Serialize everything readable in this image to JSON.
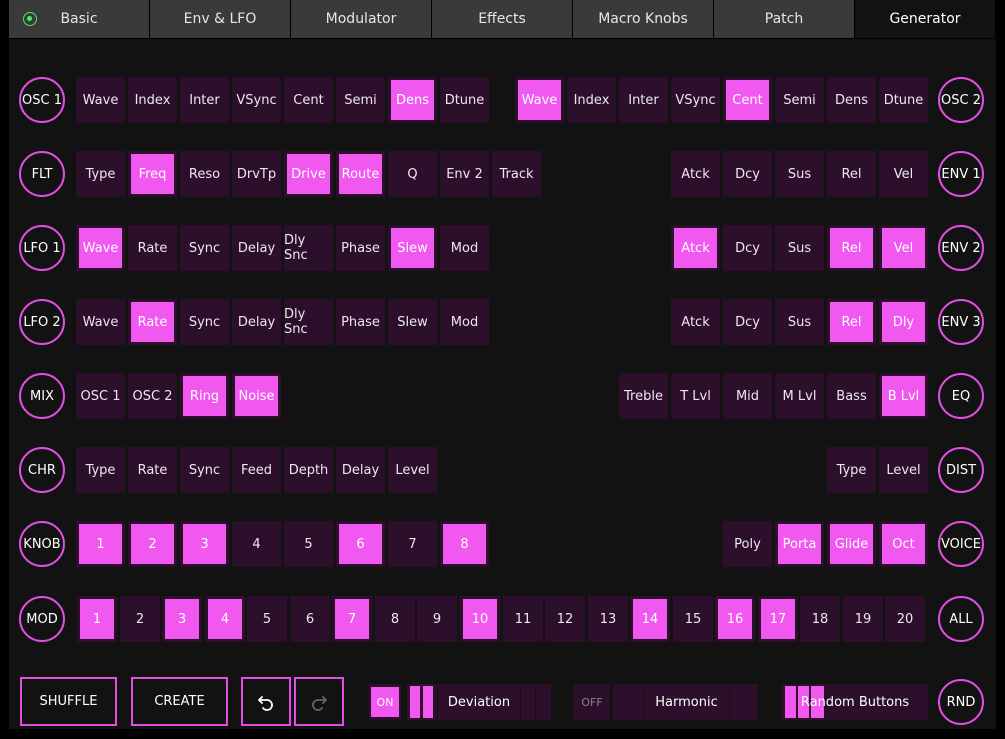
{
  "tabs": [
    {
      "label": "Basic",
      "active": false,
      "led": true
    },
    {
      "label": "Env & LFO",
      "active": false
    },
    {
      "label": "Modulator",
      "active": false
    },
    {
      "label": "Effects",
      "active": false
    },
    {
      "label": "Macro Knobs",
      "active": false
    },
    {
      "label": "Patch",
      "active": false
    },
    {
      "label": "Generator",
      "active": true
    }
  ],
  "colors": {
    "accent": "#f058f0",
    "button_off": "#2b0f2b",
    "circle_border": "#e24ee2",
    "led": "#3ef05a",
    "background": "#121212"
  },
  "rows": [
    {
      "left_label": "OSC 1",
      "right_label": "OSC 2",
      "left_buttons": [
        {
          "label": "Wave",
          "on": false
        },
        {
          "label": "Index",
          "on": false
        },
        {
          "label": "Inter",
          "on": false
        },
        {
          "label": "VSync",
          "on": false
        },
        {
          "label": "Cent",
          "on": false
        },
        {
          "label": "Semi",
          "on": false
        },
        {
          "label": "Dens",
          "on": true
        },
        {
          "label": "Dtune",
          "on": false
        }
      ],
      "right_buttons": [
        {
          "label": "Wave",
          "on": true
        },
        {
          "label": "Index",
          "on": false
        },
        {
          "label": "Inter",
          "on": false
        },
        {
          "label": "VSync",
          "on": false
        },
        {
          "label": "Cent",
          "on": true
        },
        {
          "label": "Semi",
          "on": false
        },
        {
          "label": "Dens",
          "on": false
        },
        {
          "label": "Dtune",
          "on": false
        }
      ]
    },
    {
      "left_label": "FLT",
      "right_label": "ENV 1",
      "left_buttons": [
        {
          "label": "Type",
          "on": false
        },
        {
          "label": "Freq",
          "on": true
        },
        {
          "label": "Reso",
          "on": false
        },
        {
          "label": "DrvTp",
          "on": false
        },
        {
          "label": "Drive",
          "on": true
        },
        {
          "label": "Route",
          "on": true
        },
        {
          "label": "Q",
          "on": false
        },
        {
          "label": "Env 2",
          "on": false
        },
        {
          "label": "Track",
          "on": false
        }
      ],
      "right_buttons": [
        {
          "label": "Atck",
          "on": false
        },
        {
          "label": "Dcy",
          "on": false
        },
        {
          "label": "Sus",
          "on": false
        },
        {
          "label": "Rel",
          "on": false
        },
        {
          "label": "Vel",
          "on": false
        }
      ]
    },
    {
      "left_label": "LFO 1",
      "right_label": "ENV 2",
      "left_buttons": [
        {
          "label": "Wave",
          "on": true
        },
        {
          "label": "Rate",
          "on": false
        },
        {
          "label": "Sync",
          "on": false
        },
        {
          "label": "Delay",
          "on": false
        },
        {
          "label": "Dly Snc",
          "on": false
        },
        {
          "label": "Phase",
          "on": false
        },
        {
          "label": "Slew",
          "on": true
        },
        {
          "label": "Mod",
          "on": false
        }
      ],
      "right_buttons": [
        {
          "label": "Atck",
          "on": true
        },
        {
          "label": "Dcy",
          "on": false
        },
        {
          "label": "Sus",
          "on": false
        },
        {
          "label": "Rel",
          "on": true
        },
        {
          "label": "Vel",
          "on": true
        }
      ]
    },
    {
      "left_label": "LFO 2",
      "right_label": "ENV 3",
      "left_buttons": [
        {
          "label": "Wave",
          "on": false
        },
        {
          "label": "Rate",
          "on": true
        },
        {
          "label": "Sync",
          "on": false
        },
        {
          "label": "Delay",
          "on": false
        },
        {
          "label": "Dly Snc",
          "on": false
        },
        {
          "label": "Phase",
          "on": false
        },
        {
          "label": "Slew",
          "on": false
        },
        {
          "label": "Mod",
          "on": false
        }
      ],
      "right_buttons": [
        {
          "label": "Atck",
          "on": false
        },
        {
          "label": "Dcy",
          "on": false
        },
        {
          "label": "Sus",
          "on": false
        },
        {
          "label": "Rel",
          "on": true
        },
        {
          "label": "Dly",
          "on": true
        }
      ]
    },
    {
      "left_label": "MIX",
      "right_label": "EQ",
      "left_buttons": [
        {
          "label": "OSC 1",
          "on": false
        },
        {
          "label": "OSC 2",
          "on": false
        },
        {
          "label": "Ring",
          "on": true
        },
        {
          "label": "Noise",
          "on": true
        }
      ],
      "right_buttons": [
        {
          "label": "Treble",
          "on": false
        },
        {
          "label": "T Lvl",
          "on": false
        },
        {
          "label": "Mid",
          "on": false
        },
        {
          "label": "M Lvl",
          "on": false
        },
        {
          "label": "Bass",
          "on": false
        },
        {
          "label": "B Lvl",
          "on": true
        }
      ]
    },
    {
      "left_label": "CHR",
      "right_label": "DIST",
      "left_buttons": [
        {
          "label": "Type",
          "on": false
        },
        {
          "label": "Rate",
          "on": false
        },
        {
          "label": "Sync",
          "on": false
        },
        {
          "label": "Feed",
          "on": false
        },
        {
          "label": "Depth",
          "on": false
        },
        {
          "label": "Delay",
          "on": false
        },
        {
          "label": "Level",
          "on": false
        }
      ],
      "right_buttons": [
        {
          "label": "Type",
          "on": false
        },
        {
          "label": "Level",
          "on": false
        }
      ]
    },
    {
      "left_label": "KNOB",
      "right_label": "VOICE",
      "left_buttons": [
        {
          "label": "1",
          "on": true
        },
        {
          "label": "2",
          "on": true
        },
        {
          "label": "3",
          "on": true
        },
        {
          "label": "4",
          "on": false
        },
        {
          "label": "5",
          "on": false
        },
        {
          "label": "6",
          "on": true
        },
        {
          "label": "7",
          "on": false
        },
        {
          "label": "8",
          "on": true
        }
      ],
      "right_buttons": [
        {
          "label": "Poly",
          "on": false
        },
        {
          "label": "Porta",
          "on": true
        },
        {
          "label": "Glide",
          "on": true
        },
        {
          "label": "Oct",
          "on": true
        }
      ]
    }
  ],
  "mod_row": {
    "left_label": "MOD",
    "right_label": "ALL",
    "buttons": [
      {
        "label": "1",
        "on": true
      },
      {
        "label": "2",
        "on": false
      },
      {
        "label": "3",
        "on": true
      },
      {
        "label": "4",
        "on": true
      },
      {
        "label": "5",
        "on": false
      },
      {
        "label": "6",
        "on": false
      },
      {
        "label": "7",
        "on": true
      },
      {
        "label": "8",
        "on": false
      },
      {
        "label": "9",
        "on": false
      },
      {
        "label": "10",
        "on": true
      },
      {
        "label": "11",
        "on": false
      },
      {
        "label": "12",
        "on": false
      },
      {
        "label": "13",
        "on": false
      },
      {
        "label": "14",
        "on": true
      },
      {
        "label": "15",
        "on": false
      },
      {
        "label": "16",
        "on": true
      },
      {
        "label": "17",
        "on": true
      },
      {
        "label": "18",
        "on": false
      },
      {
        "label": "19",
        "on": false
      },
      {
        "label": "20",
        "on": false
      }
    ]
  },
  "bottom": {
    "shuffle_label": "SHUFFLE",
    "create_label": "CREATE",
    "undo_icon": "undo-icon",
    "redo_icon": "redo-icon",
    "deviation": {
      "toggle_label": "ON",
      "toggle_on": true,
      "label": "Deviation"
    },
    "harmonic": {
      "toggle_label": "OFF",
      "toggle_on": false,
      "label": "Harmonic"
    },
    "random_label": "Random Buttons",
    "rnd_label": "RND"
  }
}
